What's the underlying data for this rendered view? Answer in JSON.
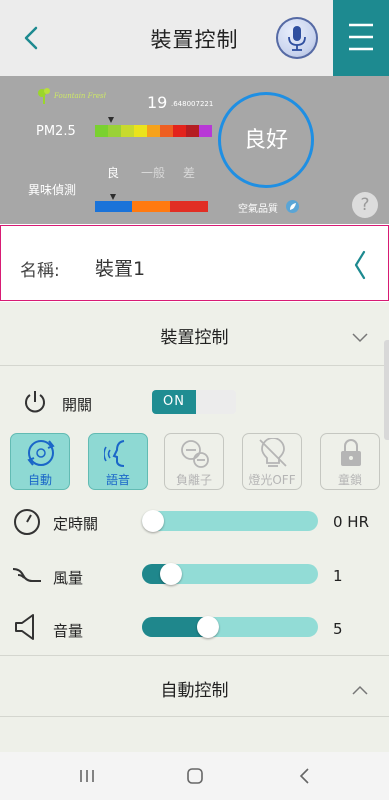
{
  "header": {
    "title": "裝置控制"
  },
  "air_quality": {
    "logo_text": "Fountain Fresh",
    "pm_label": "PM2.5",
    "pm_value_main": "19",
    "pm_value_decimals": ".648007221",
    "pm_scale_colors": [
      "#7ad130",
      "#9ad137",
      "#c8da2e",
      "#ebe31c",
      "#f6a21b",
      "#ee5f22",
      "#e3231c",
      "#b51d22",
      "#b838d6"
    ],
    "level_labels": [
      "良",
      "一般",
      "差"
    ],
    "odor_label": "異味偵測",
    "odor_scale_colors": [
      "#1a73d9",
      "#ff7a10",
      "#e12e24"
    ],
    "quality_status": "良好",
    "quality_label": "空氣品質",
    "help_text": "?",
    "accent_color": "#1f8fe3"
  },
  "device": {
    "name_label": "名稱:",
    "name_value": "裝置1"
  },
  "device_control": {
    "title": "裝置控制",
    "power_label": "開關",
    "power_state": "ON",
    "modes": [
      {
        "label": "自動",
        "active": true,
        "icon": "auto-cycle-icon"
      },
      {
        "label": "語音",
        "active": true,
        "icon": "voice-face-icon"
      },
      {
        "label": "負離子",
        "active": false,
        "icon": "negative-ion-icon"
      },
      {
        "label": "燈光OFF",
        "active": false,
        "icon": "light-off-icon"
      },
      {
        "label": "童鎖",
        "active": false,
        "icon": "lock-icon"
      }
    ],
    "timer": {
      "label": "定時關",
      "value": "0 HR",
      "level": 0.0
    },
    "fan": {
      "label": "風量",
      "value": "1",
      "level": 0.12
    },
    "volume": {
      "label": "音量",
      "value": "5",
      "level": 0.36
    }
  },
  "auto_control": {
    "title": "自動控制"
  },
  "colors": {
    "header_accent": "#1d8a90",
    "slider_fill": "#1f878c",
    "slider_track": "#92dcd6",
    "name_border": "#d81b74"
  }
}
